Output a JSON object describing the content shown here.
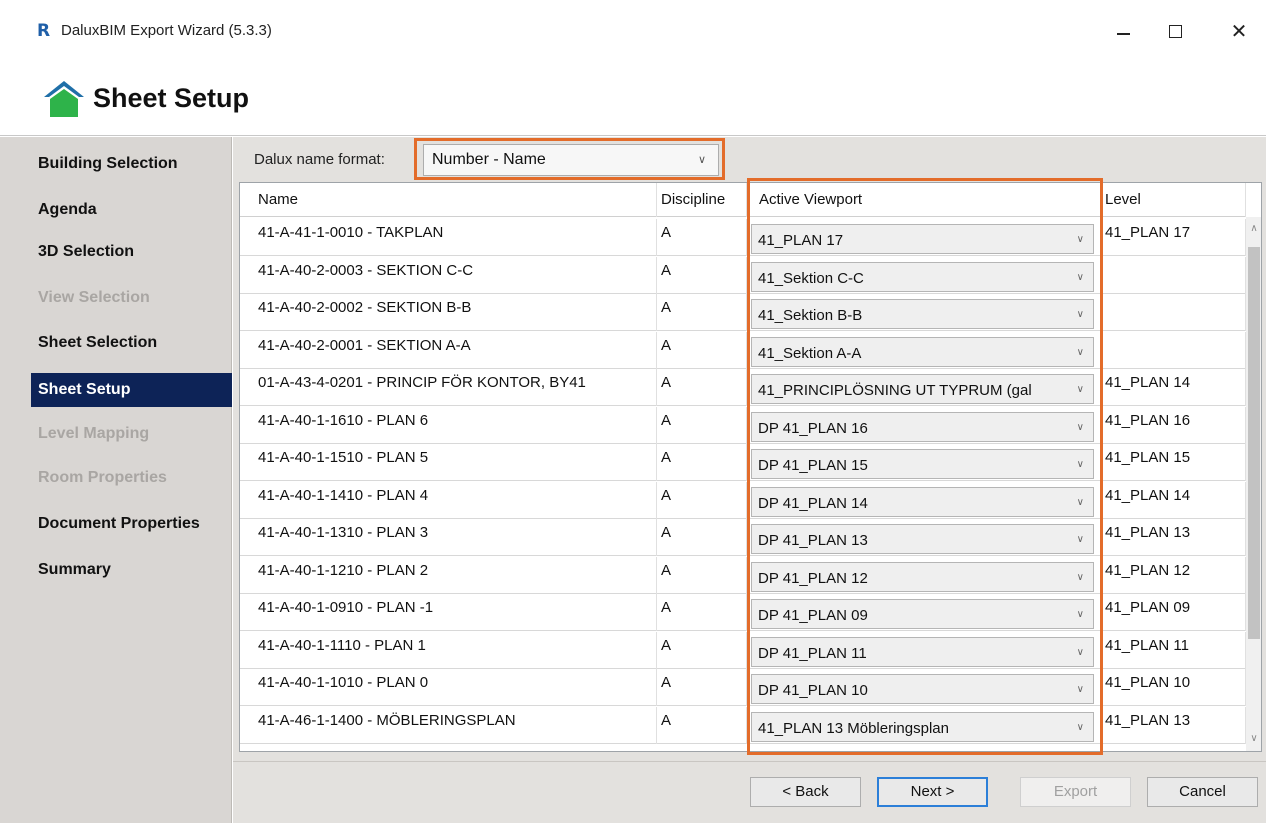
{
  "window": {
    "app_logo": "R",
    "title": "DaluxBIM Export Wizard (5.3.3)",
    "minimize_glyph": "—",
    "maximize_glyph": "☐",
    "close_glyph": "✕"
  },
  "header": {
    "title": "Sheet Setup"
  },
  "sidebar": {
    "items": [
      {
        "label": "Building Selection",
        "state": "normal"
      },
      {
        "label": "Agenda",
        "state": "normal"
      },
      {
        "label": "3D Selection",
        "state": "normal"
      },
      {
        "label": "View Selection",
        "state": "disabled"
      },
      {
        "label": "Sheet Selection",
        "state": "normal"
      },
      {
        "label": "Sheet Setup",
        "state": "active"
      },
      {
        "label": "Level Mapping",
        "state": "disabled"
      },
      {
        "label": "Room Properties",
        "state": "disabled"
      },
      {
        "label": "Document Properties",
        "state": "normal"
      },
      {
        "label": "Summary",
        "state": "normal"
      }
    ]
  },
  "format": {
    "label": "Dalux name format:",
    "value": "Number - Name"
  },
  "table": {
    "columns": [
      "Name",
      "Discipline",
      "Active Viewport",
      "Level"
    ],
    "rows": [
      {
        "name": "41-A-41-1-0010 - TAKPLAN",
        "discipline": "A",
        "viewport": "41_PLAN 17",
        "level": "41_PLAN 17"
      },
      {
        "name": "41-A-40-2-0003 - SEKTION C-C",
        "discipline": "A",
        "viewport": "41_Sektion C-C",
        "level": ""
      },
      {
        "name": "41-A-40-2-0002 - SEKTION B-B",
        "discipline": "A",
        "viewport": "41_Sektion B-B",
        "level": ""
      },
      {
        "name": "41-A-40-2-0001 - SEKTION A-A",
        "discipline": "A",
        "viewport": "41_Sektion A-A",
        "level": ""
      },
      {
        "name": "01-A-43-4-0201 - PRINCIP FÖR KONTOR, BY41",
        "discipline": "A",
        "viewport": "41_PRINCIPLÖSNING UT TYPRUM (gal",
        "level": "41_PLAN 14"
      },
      {
        "name": "41-A-40-1-1610 - PLAN 6",
        "discipline": "A",
        "viewport": "DP 41_PLAN 16",
        "level": "41_PLAN 16"
      },
      {
        "name": "41-A-40-1-1510 - PLAN 5",
        "discipline": "A",
        "viewport": "DP 41_PLAN 15",
        "level": "41_PLAN 15"
      },
      {
        "name": "41-A-40-1-1410 - PLAN 4",
        "discipline": "A",
        "viewport": "DP 41_PLAN 14",
        "level": "41_PLAN 14"
      },
      {
        "name": "41-A-40-1-1310 - PLAN 3",
        "discipline": "A",
        "viewport": "DP 41_PLAN 13",
        "level": "41_PLAN 13"
      },
      {
        "name": "41-A-40-1-1210 - PLAN 2",
        "discipline": "A",
        "viewport": "DP 41_PLAN 12",
        "level": "41_PLAN 12"
      },
      {
        "name": "41-A-40-1-0910 - PLAN -1",
        "discipline": "A",
        "viewport": "DP 41_PLAN 09",
        "level": "41_PLAN 09"
      },
      {
        "name": "41-A-40-1-1110 - PLAN 1",
        "discipline": "A",
        "viewport": "DP 41_PLAN 11",
        "level": "41_PLAN 11"
      },
      {
        "name": "41-A-40-1-1010 - PLAN 0",
        "discipline": "A",
        "viewport": "DP 41_PLAN 10",
        "level": "41_PLAN 10"
      },
      {
        "name": "41-A-46-1-1400 - MÖBLERINGSPLAN",
        "discipline": "A",
        "viewport": "41_PLAN 13 Möbleringsplan",
        "level": "41_PLAN 13"
      }
    ]
  },
  "buttons": {
    "back": "< Back",
    "next": "Next >",
    "export": "Export",
    "cancel": "Cancel"
  },
  "colors": {
    "sidebar_active": "#0d2357",
    "highlight_outline": "#e36c2a",
    "home_icon_roof": "#1f6fa8",
    "home_icon_body": "#2eb34a"
  }
}
